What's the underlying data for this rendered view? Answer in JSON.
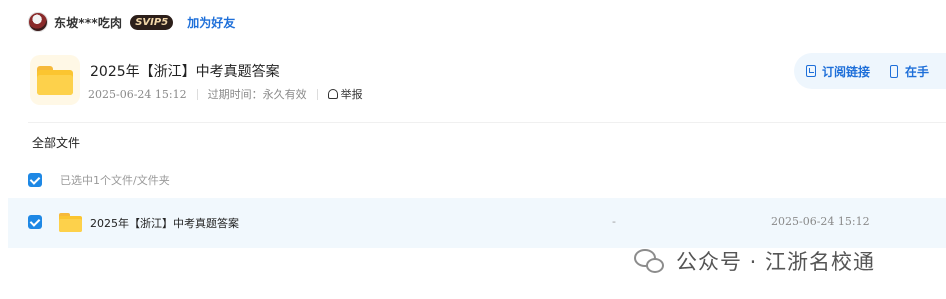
{
  "user": {
    "name": "东坡***吃肉",
    "badge": "SVIP5",
    "add_friend": "加为好友"
  },
  "share": {
    "title": "2025年【浙江】中考真题答案",
    "date": "2025-06-24 15:12",
    "expiry": "过期时间：永久有效",
    "report": "举报"
  },
  "actions": {
    "subscribe": "订阅链接",
    "phone": "在手"
  },
  "breadcrumb": "全部文件",
  "selection": {
    "text": "已选中1个文件/文件夹"
  },
  "files": [
    {
      "name": "2025年【浙江】中考真题答案",
      "size": "-",
      "date": "2025-06-24 15:12"
    }
  ],
  "watermark": {
    "text": "公众号 · 江浙名校通"
  },
  "colors": {
    "accent": "#1e6fd9",
    "checkbox": "#1e88e5",
    "row_highlight": "#f1f8fd",
    "folder": "#fbc530"
  }
}
